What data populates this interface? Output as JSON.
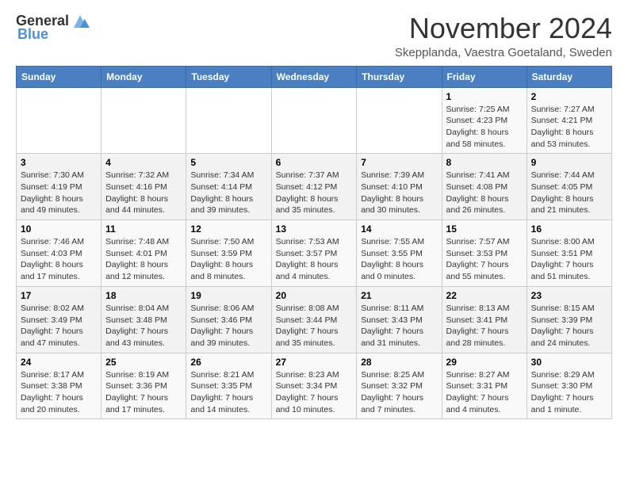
{
  "header": {
    "logo_general": "General",
    "logo_blue": "Blue",
    "month_year": "November 2024",
    "location": "Skepplanda, Vaestra Goetaland, Sweden"
  },
  "weekdays": [
    "Sunday",
    "Monday",
    "Tuesday",
    "Wednesday",
    "Thursday",
    "Friday",
    "Saturday"
  ],
  "weeks": [
    [
      {
        "day": "",
        "info": ""
      },
      {
        "day": "",
        "info": ""
      },
      {
        "day": "",
        "info": ""
      },
      {
        "day": "",
        "info": ""
      },
      {
        "day": "",
        "info": ""
      },
      {
        "day": "1",
        "info": "Sunrise: 7:25 AM\nSunset: 4:23 PM\nDaylight: 8 hours\nand 58 minutes."
      },
      {
        "day": "2",
        "info": "Sunrise: 7:27 AM\nSunset: 4:21 PM\nDaylight: 8 hours\nand 53 minutes."
      }
    ],
    [
      {
        "day": "3",
        "info": "Sunrise: 7:30 AM\nSunset: 4:19 PM\nDaylight: 8 hours\nand 49 minutes."
      },
      {
        "day": "4",
        "info": "Sunrise: 7:32 AM\nSunset: 4:16 PM\nDaylight: 8 hours\nand 44 minutes."
      },
      {
        "day": "5",
        "info": "Sunrise: 7:34 AM\nSunset: 4:14 PM\nDaylight: 8 hours\nand 39 minutes."
      },
      {
        "day": "6",
        "info": "Sunrise: 7:37 AM\nSunset: 4:12 PM\nDaylight: 8 hours\nand 35 minutes."
      },
      {
        "day": "7",
        "info": "Sunrise: 7:39 AM\nSunset: 4:10 PM\nDaylight: 8 hours\nand 30 minutes."
      },
      {
        "day": "8",
        "info": "Sunrise: 7:41 AM\nSunset: 4:08 PM\nDaylight: 8 hours\nand 26 minutes."
      },
      {
        "day": "9",
        "info": "Sunrise: 7:44 AM\nSunset: 4:05 PM\nDaylight: 8 hours\nand 21 minutes."
      }
    ],
    [
      {
        "day": "10",
        "info": "Sunrise: 7:46 AM\nSunset: 4:03 PM\nDaylight: 8 hours\nand 17 minutes."
      },
      {
        "day": "11",
        "info": "Sunrise: 7:48 AM\nSunset: 4:01 PM\nDaylight: 8 hours\nand 12 minutes."
      },
      {
        "day": "12",
        "info": "Sunrise: 7:50 AM\nSunset: 3:59 PM\nDaylight: 8 hours\nand 8 minutes."
      },
      {
        "day": "13",
        "info": "Sunrise: 7:53 AM\nSunset: 3:57 PM\nDaylight: 8 hours\nand 4 minutes."
      },
      {
        "day": "14",
        "info": "Sunrise: 7:55 AM\nSunset: 3:55 PM\nDaylight: 8 hours\nand 0 minutes."
      },
      {
        "day": "15",
        "info": "Sunrise: 7:57 AM\nSunset: 3:53 PM\nDaylight: 7 hours\nand 55 minutes."
      },
      {
        "day": "16",
        "info": "Sunrise: 8:00 AM\nSunset: 3:51 PM\nDaylight: 7 hours\nand 51 minutes."
      }
    ],
    [
      {
        "day": "17",
        "info": "Sunrise: 8:02 AM\nSunset: 3:49 PM\nDaylight: 7 hours\nand 47 minutes."
      },
      {
        "day": "18",
        "info": "Sunrise: 8:04 AM\nSunset: 3:48 PM\nDaylight: 7 hours\nand 43 minutes."
      },
      {
        "day": "19",
        "info": "Sunrise: 8:06 AM\nSunset: 3:46 PM\nDaylight: 7 hours\nand 39 minutes."
      },
      {
        "day": "20",
        "info": "Sunrise: 8:08 AM\nSunset: 3:44 PM\nDaylight: 7 hours\nand 35 minutes."
      },
      {
        "day": "21",
        "info": "Sunrise: 8:11 AM\nSunset: 3:43 PM\nDaylight: 7 hours\nand 31 minutes."
      },
      {
        "day": "22",
        "info": "Sunrise: 8:13 AM\nSunset: 3:41 PM\nDaylight: 7 hours\nand 28 minutes."
      },
      {
        "day": "23",
        "info": "Sunrise: 8:15 AM\nSunset: 3:39 PM\nDaylight: 7 hours\nand 24 minutes."
      }
    ],
    [
      {
        "day": "24",
        "info": "Sunrise: 8:17 AM\nSunset: 3:38 PM\nDaylight: 7 hours\nand 20 minutes."
      },
      {
        "day": "25",
        "info": "Sunrise: 8:19 AM\nSunset: 3:36 PM\nDaylight: 7 hours\nand 17 minutes."
      },
      {
        "day": "26",
        "info": "Sunrise: 8:21 AM\nSunset: 3:35 PM\nDaylight: 7 hours\nand 14 minutes."
      },
      {
        "day": "27",
        "info": "Sunrise: 8:23 AM\nSunset: 3:34 PM\nDaylight: 7 hours\nand 10 minutes."
      },
      {
        "day": "28",
        "info": "Sunrise: 8:25 AM\nSunset: 3:32 PM\nDaylight: 7 hours\nand 7 minutes."
      },
      {
        "day": "29",
        "info": "Sunrise: 8:27 AM\nSunset: 3:31 PM\nDaylight: 7 hours\nand 4 minutes."
      },
      {
        "day": "30",
        "info": "Sunrise: 8:29 AM\nSunset: 3:30 PM\nDaylight: 7 hours\nand 1 minute."
      }
    ]
  ]
}
